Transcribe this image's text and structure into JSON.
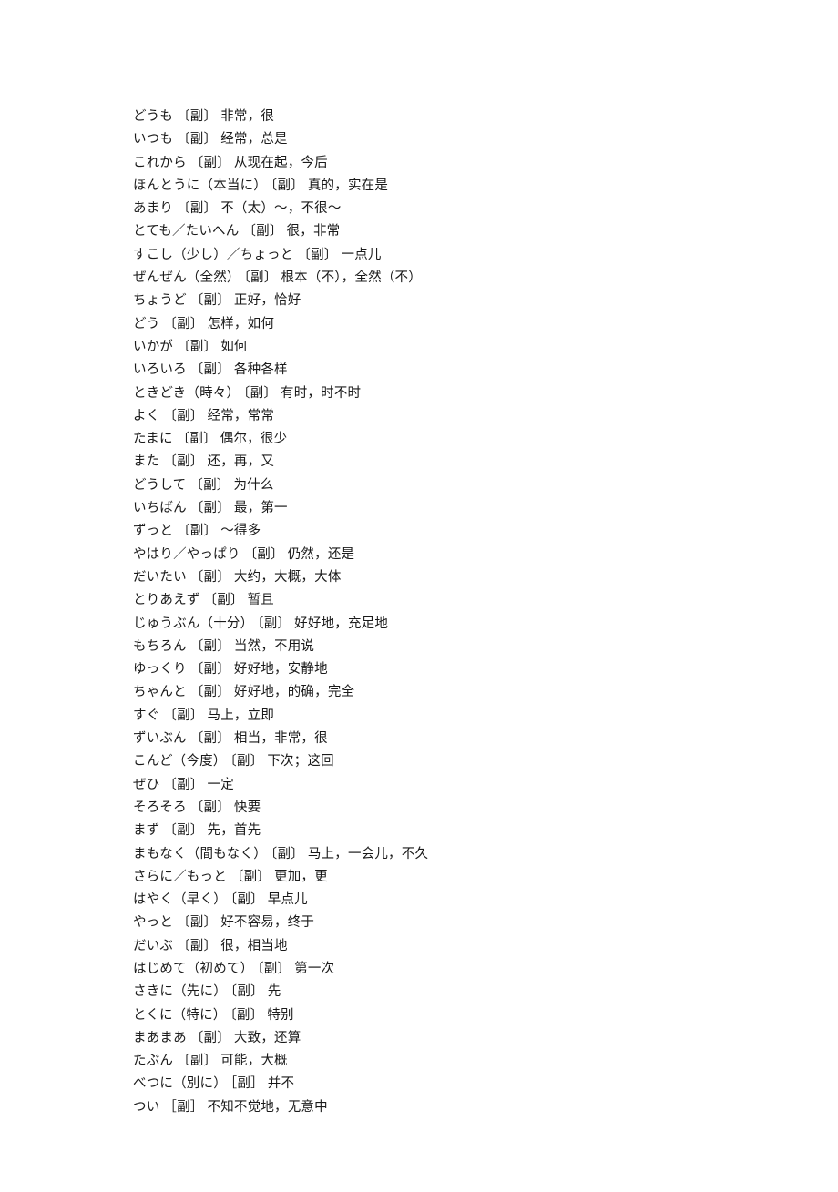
{
  "entries": [
    {
      "word": "どうも",
      "pos": "〔副〕",
      "meaning": "非常，很"
    },
    {
      "word": "いつも",
      "pos": "〔副〕",
      "meaning": "经常，总是"
    },
    {
      "word": "これから",
      "pos": "〔副〕",
      "meaning": "从现在起，今后"
    },
    {
      "word": "ほんとうに（本当に）",
      "pos": "〔副〕",
      "meaning": "真的，实在是"
    },
    {
      "word": "あまり",
      "pos": "〔副〕",
      "meaning": "不（太）～，不很～"
    },
    {
      "word": "とても／たいへん",
      "pos": "〔副〕",
      "meaning": "很，非常"
    },
    {
      "word": "すこし（少し）／ちょっと",
      "pos": "〔副〕",
      "meaning": "一点儿"
    },
    {
      "word": "ぜんぜん（全然）",
      "pos": "〔副〕",
      "meaning": "根本（不），全然（不）"
    },
    {
      "word": "ちょうど",
      "pos": "〔副〕",
      "meaning": "正好，恰好"
    },
    {
      "word": "どう",
      "pos": "〔副〕",
      "meaning": "怎样，如何"
    },
    {
      "word": "いかが",
      "pos": "〔副〕",
      "meaning": "如何"
    },
    {
      "word": "いろいろ",
      "pos": "〔副〕",
      "meaning": "各种各样"
    },
    {
      "word": "ときどき（時々）",
      "pos": "〔副〕",
      "meaning": "有时，时不时"
    },
    {
      "word": "よく",
      "pos": "〔副〕",
      "meaning": "经常，常常"
    },
    {
      "word": "たまに",
      "pos": "〔副〕",
      "meaning": "偶尔，很少"
    },
    {
      "word": "また",
      "pos": "〔副〕",
      "meaning": "还，再，又"
    },
    {
      "word": "どうして",
      "pos": "〔副〕",
      "meaning": "为什么"
    },
    {
      "word": "いちばん",
      "pos": "〔副〕",
      "meaning": "最，第一"
    },
    {
      "word": "ずっと",
      "pos": "〔副〕",
      "meaning": "～得多"
    },
    {
      "word": "やはり／やっぱり",
      "pos": "〔副〕",
      "meaning": "仍然，还是"
    },
    {
      "word": "だいたい",
      "pos": "〔副〕",
      "meaning": "大约，大概，大体"
    },
    {
      "word": "とりあえず",
      "pos": "〔副〕",
      "meaning": "暂且"
    },
    {
      "word": "じゅうぶん（十分）",
      "pos": "〔副〕",
      "meaning": "好好地，充足地"
    },
    {
      "word": "もちろん",
      "pos": "〔副〕",
      "meaning": "当然，不用说"
    },
    {
      "word": "ゆっくり",
      "pos": "〔副〕",
      "meaning": "好好地，安静地"
    },
    {
      "word": "ちゃんと",
      "pos": "〔副〕",
      "meaning": "好好地，的确，完全"
    },
    {
      "word": "すぐ",
      "pos": "〔副〕",
      "meaning": "马上，立即"
    },
    {
      "word": "ずいぶん",
      "pos": "〔副〕",
      "meaning": "相当，非常，很"
    },
    {
      "word": "こんど（今度）",
      "pos": "〔副〕",
      "meaning": "下次；这回"
    },
    {
      "word": "ぜひ",
      "pos": "〔副〕",
      "meaning": "一定"
    },
    {
      "word": "そろそろ",
      "pos": "〔副〕",
      "meaning": "快要"
    },
    {
      "word": "まず",
      "pos": "〔副〕",
      "meaning": "先，首先"
    },
    {
      "word": "まもなく（間もなく）",
      "pos": "〔副〕",
      "meaning": "马上，一会儿，不久"
    },
    {
      "word": "さらに／もっと",
      "pos": "〔副〕",
      "meaning": "更加，更"
    },
    {
      "word": "はやく（早く）",
      "pos": "〔副〕",
      "meaning": "早点儿"
    },
    {
      "word": "やっと",
      "pos": "〔副〕",
      "meaning": "好不容易，终于"
    },
    {
      "word": "だいぶ",
      "pos": "〔副〕",
      "meaning": "很，相当地"
    },
    {
      "word": "はじめて（初めて）",
      "pos": "〔副〕",
      "meaning": "第一次"
    },
    {
      "word": "さきに（先に）",
      "pos": "〔副〕",
      "meaning": "先"
    },
    {
      "word": "とくに（特に）",
      "pos": "〔副〕",
      "meaning": "特别"
    },
    {
      "word": "まあまあ",
      "pos": "〔副〕",
      "meaning": "大致，还算"
    },
    {
      "word": "たぶん",
      "pos": "〔副〕",
      "meaning": "可能，大概"
    },
    {
      "word": "べつに（別に）",
      "pos": "［副］",
      "meaning": "并不"
    },
    {
      "word": "つい",
      "pos": "［副］",
      "meaning": "不知不觉地，无意中"
    }
  ]
}
